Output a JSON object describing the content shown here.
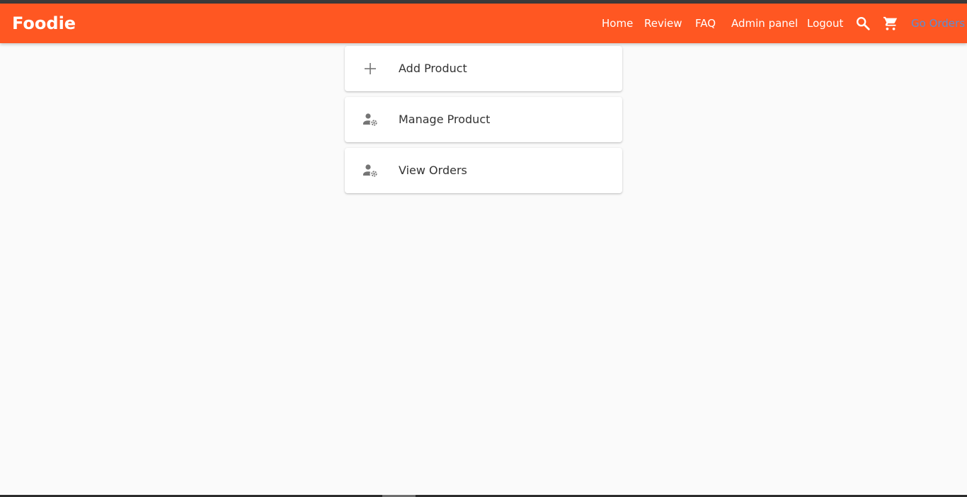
{
  "brand": "Foodie",
  "colors": {
    "navbar": "#ff5722",
    "nav_text": "#ffffff",
    "orders_link": "#5b8fd6",
    "background": "#fafafa",
    "card_text": "#333333",
    "icon": "#757575"
  },
  "nav": {
    "home": "Home",
    "review": "Review",
    "faq": "FAQ",
    "admin_panel": "Admin panel",
    "logout": "Logout",
    "search_icon": "search-icon",
    "cart_icon": "cart-icon",
    "go_orders": "Go Orders"
  },
  "admin_menu": [
    {
      "label": "Add Product",
      "icon": "plus-icon"
    },
    {
      "label": "Manage Product",
      "icon": "user-settings-icon"
    },
    {
      "label": "View Orders",
      "icon": "user-settings-icon"
    }
  ]
}
